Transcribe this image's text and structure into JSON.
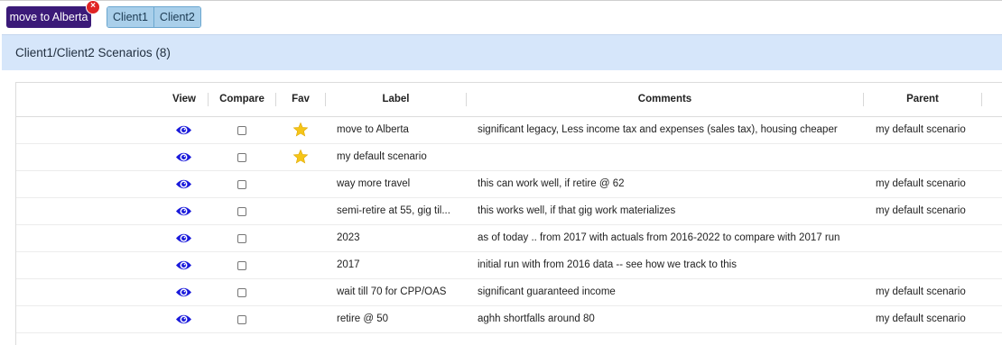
{
  "active_scenario": {
    "label": "move to Alberta",
    "close_glyph": "×"
  },
  "clients": [
    "Client1",
    "Client2"
  ],
  "section": {
    "title": "Client1/Client2 Scenarios (8)"
  },
  "columns": {
    "view": "View",
    "compare": "Compare",
    "fav": "Fav",
    "label": "Label",
    "comments": "Comments",
    "parent": "Parent"
  },
  "icons": {
    "view": "eye-icon",
    "fav": "star-icon"
  },
  "colors": {
    "active_pill": "#3b1a78",
    "close_badge": "#e02424",
    "client_button": "#a9cfea",
    "header_band": "#d6e6fa",
    "eye": "#1a1adb",
    "star": "#f5c518"
  },
  "rows": [
    {
      "label": "move to Alberta",
      "comment": "significant legacy, Less income tax and expenses (sales tax), housing cheaper",
      "parent": "my default scenario",
      "fav": true,
      "compare": false
    },
    {
      "label": "my default scenario",
      "comment": "",
      "parent": "",
      "fav": true,
      "compare": false
    },
    {
      "label": "way more travel",
      "comment": "this can work well, if retire @ 62",
      "parent": "my default scenario",
      "fav": false,
      "compare": false
    },
    {
      "label": "semi-retire at 55, gig til...",
      "comment": "this works well, if that gig work materializes",
      "parent": "my default scenario",
      "fav": false,
      "compare": false
    },
    {
      "label": "2023",
      "comment": "as of today .. from 2017 with actuals from 2016-2022 to compare with 2017 run",
      "parent": "",
      "fav": false,
      "compare": false
    },
    {
      "label": "2017",
      "comment": "initial run with from 2016 data -- see how we track to this",
      "parent": "",
      "fav": false,
      "compare": false
    },
    {
      "label": "wait till 70 for CPP/OAS",
      "comment": "significant guaranteed income",
      "parent": "my default scenario",
      "fav": false,
      "compare": false
    },
    {
      "label": "retire @ 50",
      "comment": "aghh shortfalls around 80",
      "parent": "my default scenario",
      "fav": false,
      "compare": false
    }
  ]
}
